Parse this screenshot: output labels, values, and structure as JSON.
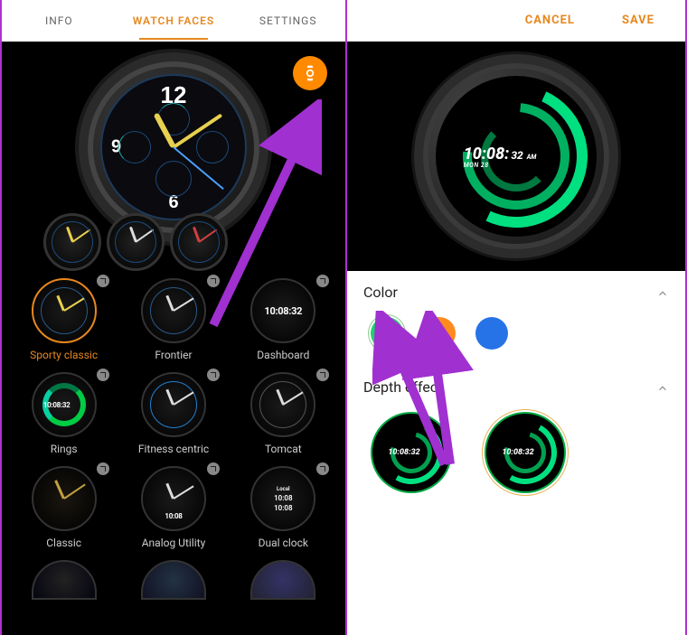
{
  "left": {
    "tabs": [
      "INFO",
      "WATCH FACES",
      "SETTINGS"
    ],
    "activeTab": 1,
    "hero": {
      "num12": "12",
      "num6": "6",
      "num9": "9"
    },
    "faces": [
      {
        "label": "Sporty classic",
        "style": "sporty",
        "selected": true
      },
      {
        "label": "Frontier",
        "style": "frontier"
      },
      {
        "label": "Dashboard",
        "style": "dashboard",
        "digital": "10:08:32"
      },
      {
        "label": "Rings",
        "style": "rings",
        "digital": "10:08:32"
      },
      {
        "label": "Fitness centric",
        "style": "fitness"
      },
      {
        "label": "Tomcat",
        "style": "tomcat"
      },
      {
        "label": "Classic",
        "style": "classic"
      },
      {
        "label": "Analog Utility",
        "style": "analogutil",
        "digital": "10:08"
      },
      {
        "label": "Dual clock",
        "style": "dual",
        "digital": "10:08",
        "city": "Local"
      }
    ]
  },
  "right": {
    "cancel": "CANCEL",
    "save": "SAVE",
    "preview": {
      "time_main": "10:08:",
      "time_sec": "32",
      "ampm": "AM",
      "date": "MON 28"
    },
    "sections": {
      "color": {
        "title": "Color",
        "swatches": [
          {
            "name": "green",
            "hex": "#1dd36f",
            "selected": true
          },
          {
            "name": "orange",
            "hex": "#ff8a1e"
          },
          {
            "name": "blue",
            "hex": "#2673e8"
          }
        ]
      },
      "depth": {
        "title": "Depth effect",
        "options": [
          {
            "time": "10:08:32",
            "selected": false
          },
          {
            "time": "10:08:32",
            "selected": true
          }
        ]
      }
    }
  }
}
